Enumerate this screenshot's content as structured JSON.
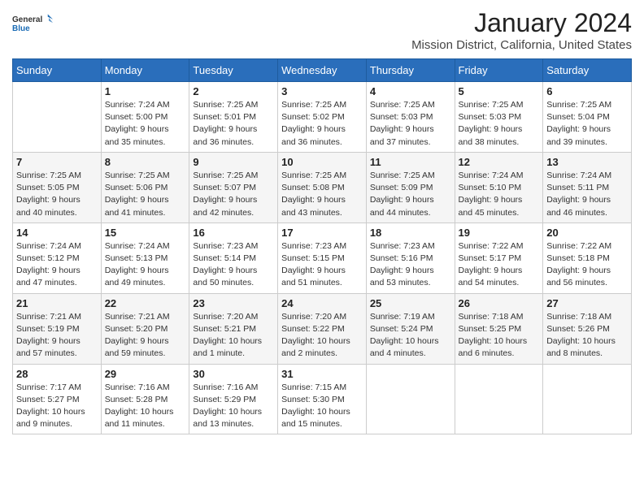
{
  "logo": {
    "general": "General",
    "blue": "Blue"
  },
  "title": "January 2024",
  "subtitle": "Mission District, California, United States",
  "weekdays": [
    "Sunday",
    "Monday",
    "Tuesday",
    "Wednesday",
    "Thursday",
    "Friday",
    "Saturday"
  ],
  "weeks": [
    [
      {
        "day": "",
        "info": ""
      },
      {
        "day": "1",
        "info": "Sunrise: 7:24 AM\nSunset: 5:00 PM\nDaylight: 9 hours\nand 35 minutes."
      },
      {
        "day": "2",
        "info": "Sunrise: 7:25 AM\nSunset: 5:01 PM\nDaylight: 9 hours\nand 36 minutes."
      },
      {
        "day": "3",
        "info": "Sunrise: 7:25 AM\nSunset: 5:02 PM\nDaylight: 9 hours\nand 36 minutes."
      },
      {
        "day": "4",
        "info": "Sunrise: 7:25 AM\nSunset: 5:03 PM\nDaylight: 9 hours\nand 37 minutes."
      },
      {
        "day": "5",
        "info": "Sunrise: 7:25 AM\nSunset: 5:03 PM\nDaylight: 9 hours\nand 38 minutes."
      },
      {
        "day": "6",
        "info": "Sunrise: 7:25 AM\nSunset: 5:04 PM\nDaylight: 9 hours\nand 39 minutes."
      }
    ],
    [
      {
        "day": "7",
        "info": "Sunrise: 7:25 AM\nSunset: 5:05 PM\nDaylight: 9 hours\nand 40 minutes."
      },
      {
        "day": "8",
        "info": "Sunrise: 7:25 AM\nSunset: 5:06 PM\nDaylight: 9 hours\nand 41 minutes."
      },
      {
        "day": "9",
        "info": "Sunrise: 7:25 AM\nSunset: 5:07 PM\nDaylight: 9 hours\nand 42 minutes."
      },
      {
        "day": "10",
        "info": "Sunrise: 7:25 AM\nSunset: 5:08 PM\nDaylight: 9 hours\nand 43 minutes."
      },
      {
        "day": "11",
        "info": "Sunrise: 7:25 AM\nSunset: 5:09 PM\nDaylight: 9 hours\nand 44 minutes."
      },
      {
        "day": "12",
        "info": "Sunrise: 7:24 AM\nSunset: 5:10 PM\nDaylight: 9 hours\nand 45 minutes."
      },
      {
        "day": "13",
        "info": "Sunrise: 7:24 AM\nSunset: 5:11 PM\nDaylight: 9 hours\nand 46 minutes."
      }
    ],
    [
      {
        "day": "14",
        "info": "Sunrise: 7:24 AM\nSunset: 5:12 PM\nDaylight: 9 hours\nand 47 minutes."
      },
      {
        "day": "15",
        "info": "Sunrise: 7:24 AM\nSunset: 5:13 PM\nDaylight: 9 hours\nand 49 minutes."
      },
      {
        "day": "16",
        "info": "Sunrise: 7:23 AM\nSunset: 5:14 PM\nDaylight: 9 hours\nand 50 minutes."
      },
      {
        "day": "17",
        "info": "Sunrise: 7:23 AM\nSunset: 5:15 PM\nDaylight: 9 hours\nand 51 minutes."
      },
      {
        "day": "18",
        "info": "Sunrise: 7:23 AM\nSunset: 5:16 PM\nDaylight: 9 hours\nand 53 minutes."
      },
      {
        "day": "19",
        "info": "Sunrise: 7:22 AM\nSunset: 5:17 PM\nDaylight: 9 hours\nand 54 minutes."
      },
      {
        "day": "20",
        "info": "Sunrise: 7:22 AM\nSunset: 5:18 PM\nDaylight: 9 hours\nand 56 minutes."
      }
    ],
    [
      {
        "day": "21",
        "info": "Sunrise: 7:21 AM\nSunset: 5:19 PM\nDaylight: 9 hours\nand 57 minutes."
      },
      {
        "day": "22",
        "info": "Sunrise: 7:21 AM\nSunset: 5:20 PM\nDaylight: 9 hours\nand 59 minutes."
      },
      {
        "day": "23",
        "info": "Sunrise: 7:20 AM\nSunset: 5:21 PM\nDaylight: 10 hours\nand 1 minute."
      },
      {
        "day": "24",
        "info": "Sunrise: 7:20 AM\nSunset: 5:22 PM\nDaylight: 10 hours\nand 2 minutes."
      },
      {
        "day": "25",
        "info": "Sunrise: 7:19 AM\nSunset: 5:24 PM\nDaylight: 10 hours\nand 4 minutes."
      },
      {
        "day": "26",
        "info": "Sunrise: 7:18 AM\nSunset: 5:25 PM\nDaylight: 10 hours\nand 6 minutes."
      },
      {
        "day": "27",
        "info": "Sunrise: 7:18 AM\nSunset: 5:26 PM\nDaylight: 10 hours\nand 8 minutes."
      }
    ],
    [
      {
        "day": "28",
        "info": "Sunrise: 7:17 AM\nSunset: 5:27 PM\nDaylight: 10 hours\nand 9 minutes."
      },
      {
        "day": "29",
        "info": "Sunrise: 7:16 AM\nSunset: 5:28 PM\nDaylight: 10 hours\nand 11 minutes."
      },
      {
        "day": "30",
        "info": "Sunrise: 7:16 AM\nSunset: 5:29 PM\nDaylight: 10 hours\nand 13 minutes."
      },
      {
        "day": "31",
        "info": "Sunrise: 7:15 AM\nSunset: 5:30 PM\nDaylight: 10 hours\nand 15 minutes."
      },
      {
        "day": "",
        "info": ""
      },
      {
        "day": "",
        "info": ""
      },
      {
        "day": "",
        "info": ""
      }
    ]
  ]
}
